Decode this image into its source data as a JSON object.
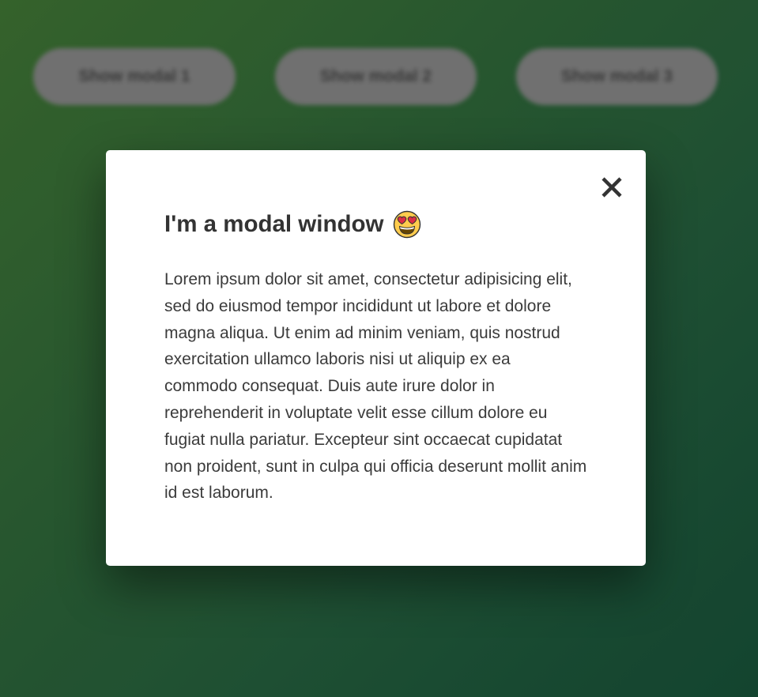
{
  "buttons": {
    "show_modal_1": "Show modal 1",
    "show_modal_2": "Show modal 2",
    "show_modal_3": "Show modal 3"
  },
  "modal": {
    "title": "I'm a modal window",
    "title_icon": "heart-eyes-emoji-icon",
    "close_icon": "close-icon",
    "body": "Lorem ipsum dolor sit amet, consectetur adipisicing elit, sed do eiusmod tempor incididunt ut labore et dolore magna aliqua. Ut enim ad minim veniam, quis nostrud exercitation ullamco laboris nisi ut aliquip ex ea commodo consequat. Duis aute irure dolor in reprehenderit in voluptate velit esse cillum dolore eu fugiat nulla pariatur. Excepteur sint occaecat cupidatat non proident, sunt in culpa qui officia deserunt mollit anim id est laborum."
  },
  "colors": {
    "background_start": "#3a6b2f",
    "background_end": "#154a34",
    "modal_background": "#ffffff",
    "text": "#333333",
    "button_background": "#7a7a7a"
  }
}
